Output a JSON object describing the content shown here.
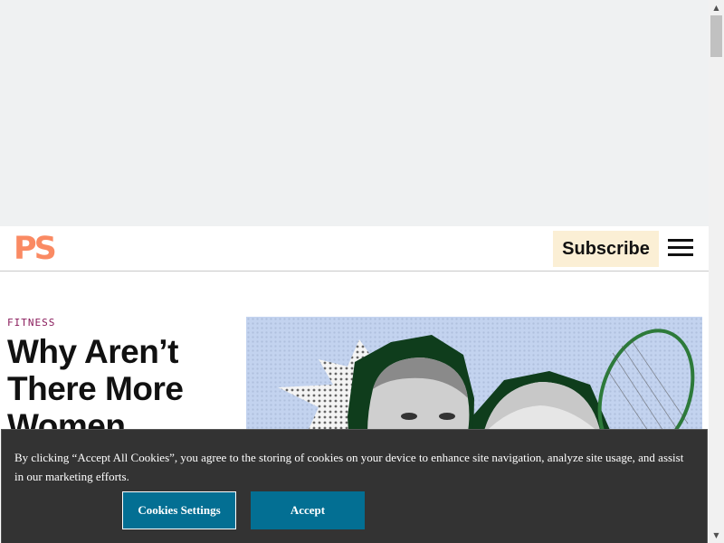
{
  "header": {
    "logo": "PS",
    "subscribe_label": "Subscribe",
    "menu_icon": "hamburger-menu-icon"
  },
  "article": {
    "category": "FITNESS",
    "headline": "Why Aren’t There More Women…"
  },
  "hero": {
    "description_icon": "tennis-players-collage"
  },
  "cookie_banner": {
    "text": "By clicking “Accept All Cookies”, you agree to the storing of cookies on your device to enhance site navigation, analyze site usage, and assist in our marketing efforts.",
    "settings_label": "Cookies Settings",
    "accept_label": "Accept"
  },
  "scrollbar": {
    "up_icon": "▲",
    "down_icon": "▼"
  },
  "colors": {
    "brand": "#fa8a63",
    "subscribe_bg": "#fbefd5",
    "category": "#8a1c5c",
    "cookie_bg": "#333333",
    "button": "#036f93",
    "hero_bg": "#c3d3ef"
  }
}
